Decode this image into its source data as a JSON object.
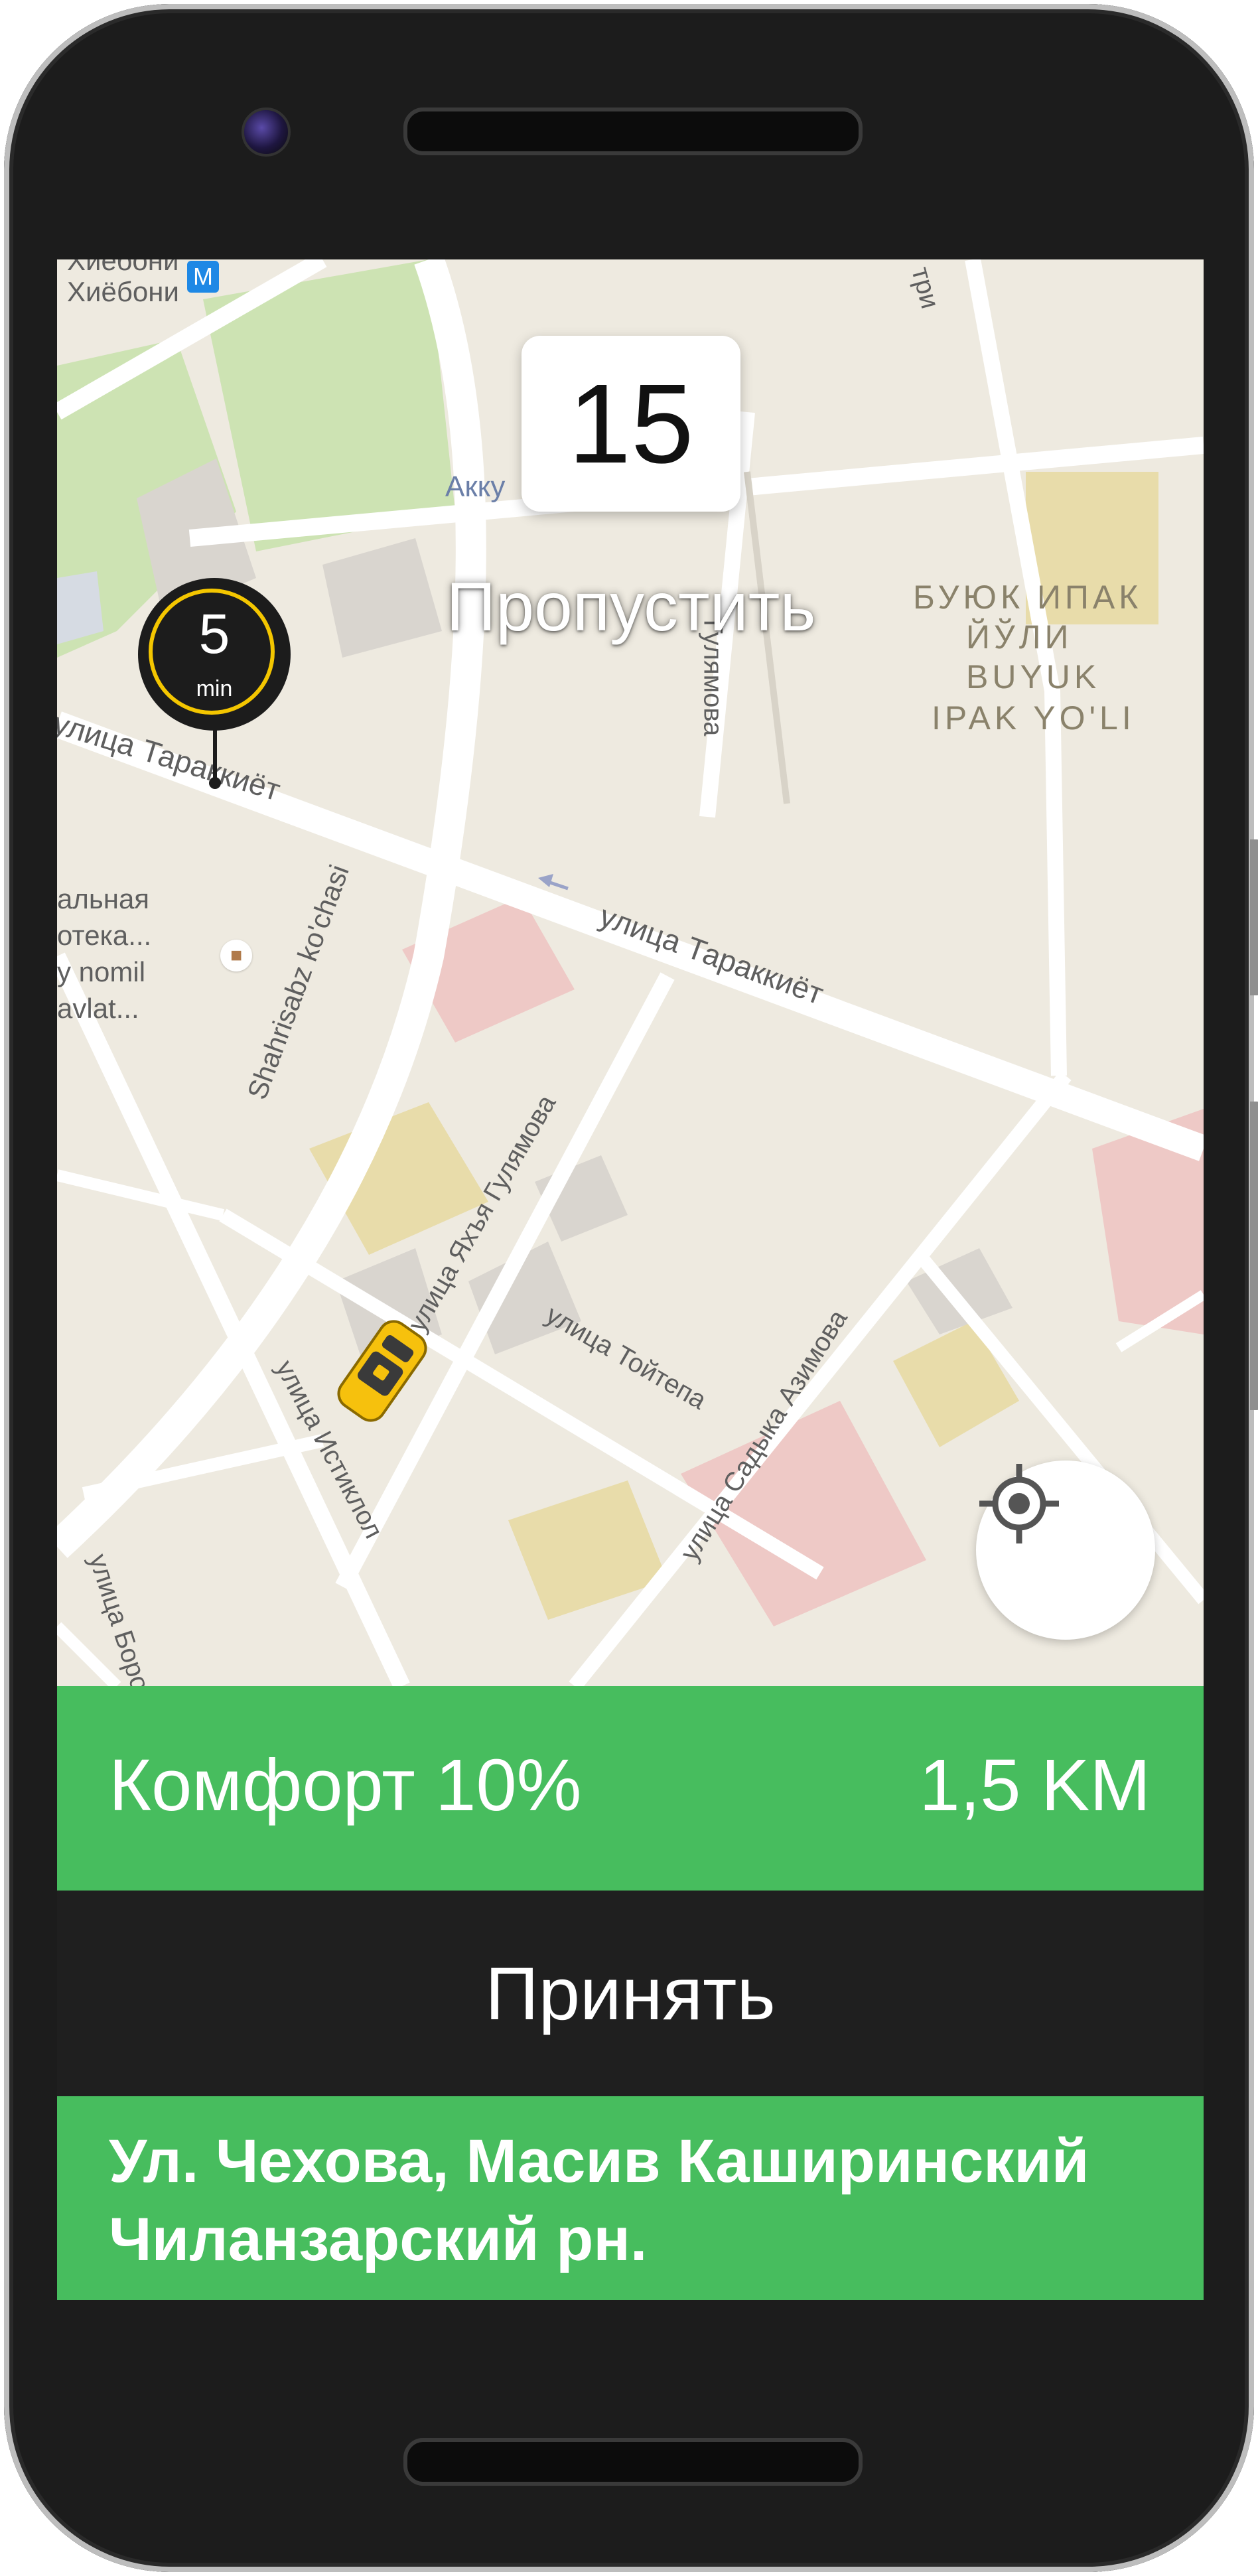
{
  "timer": {
    "value": "15"
  },
  "skip_label": "Пропустить",
  "eta_pin": {
    "value": "5",
    "unit": "min"
  },
  "map": {
    "labels": {
      "metro_1": "Хиебони",
      "metro_2": "Хиёбони",
      "metro_badge": "M",
      "akku": "Акку",
      "gulyamova_top": "Гулямова",
      "buyuk_1": "БУЮК ИПАК",
      "buyuk_2": "ЙЎЛИ",
      "buyuk_3": "BUYUK",
      "buyuk_4": "IPAK YO'LI",
      "trakkiyot_left": "улица Тараккиёт",
      "trakkiyot_right": "улица Тараккиёт",
      "shahrisabz": "Shahrisabz ko'chasi",
      "library_1": "альная",
      "library_2": "отека...",
      "library_3": "y nomil",
      "library_4": "avlat...",
      "yahya": "улица Яхъя Гулямова",
      "toytepa": "улица Тойтепа",
      "sadyk": "улица Садыка Азимова",
      "istiklol": "улица Истиклол",
      "borov": "улица Боров",
      "top_right": "три"
    }
  },
  "colors": {
    "map_bg": "#eeeae0",
    "road": "#ffffff",
    "park": "#cde3b3",
    "building_tan": "#e8dcaa",
    "building_pink": "#eec9c6",
    "building_gray": "#d9d5cf",
    "green_bar": "#47bd5e",
    "dark_bar": "#1f1f1f",
    "pin_ring": "#f4c600",
    "taxi": "#f6c10d"
  },
  "icons": {
    "locate": "crosshair-locate-icon",
    "taxi": "taxi-car-icon",
    "library": "library-book-icon",
    "one_way": "one-way-arrow-icon"
  },
  "order": {
    "tariff": "Комфорт 10%",
    "distance": "1,5 KM",
    "accept_label": "Принять",
    "address": "Ул. Чехова, Масив Каширинский Чиланзарский рн."
  }
}
